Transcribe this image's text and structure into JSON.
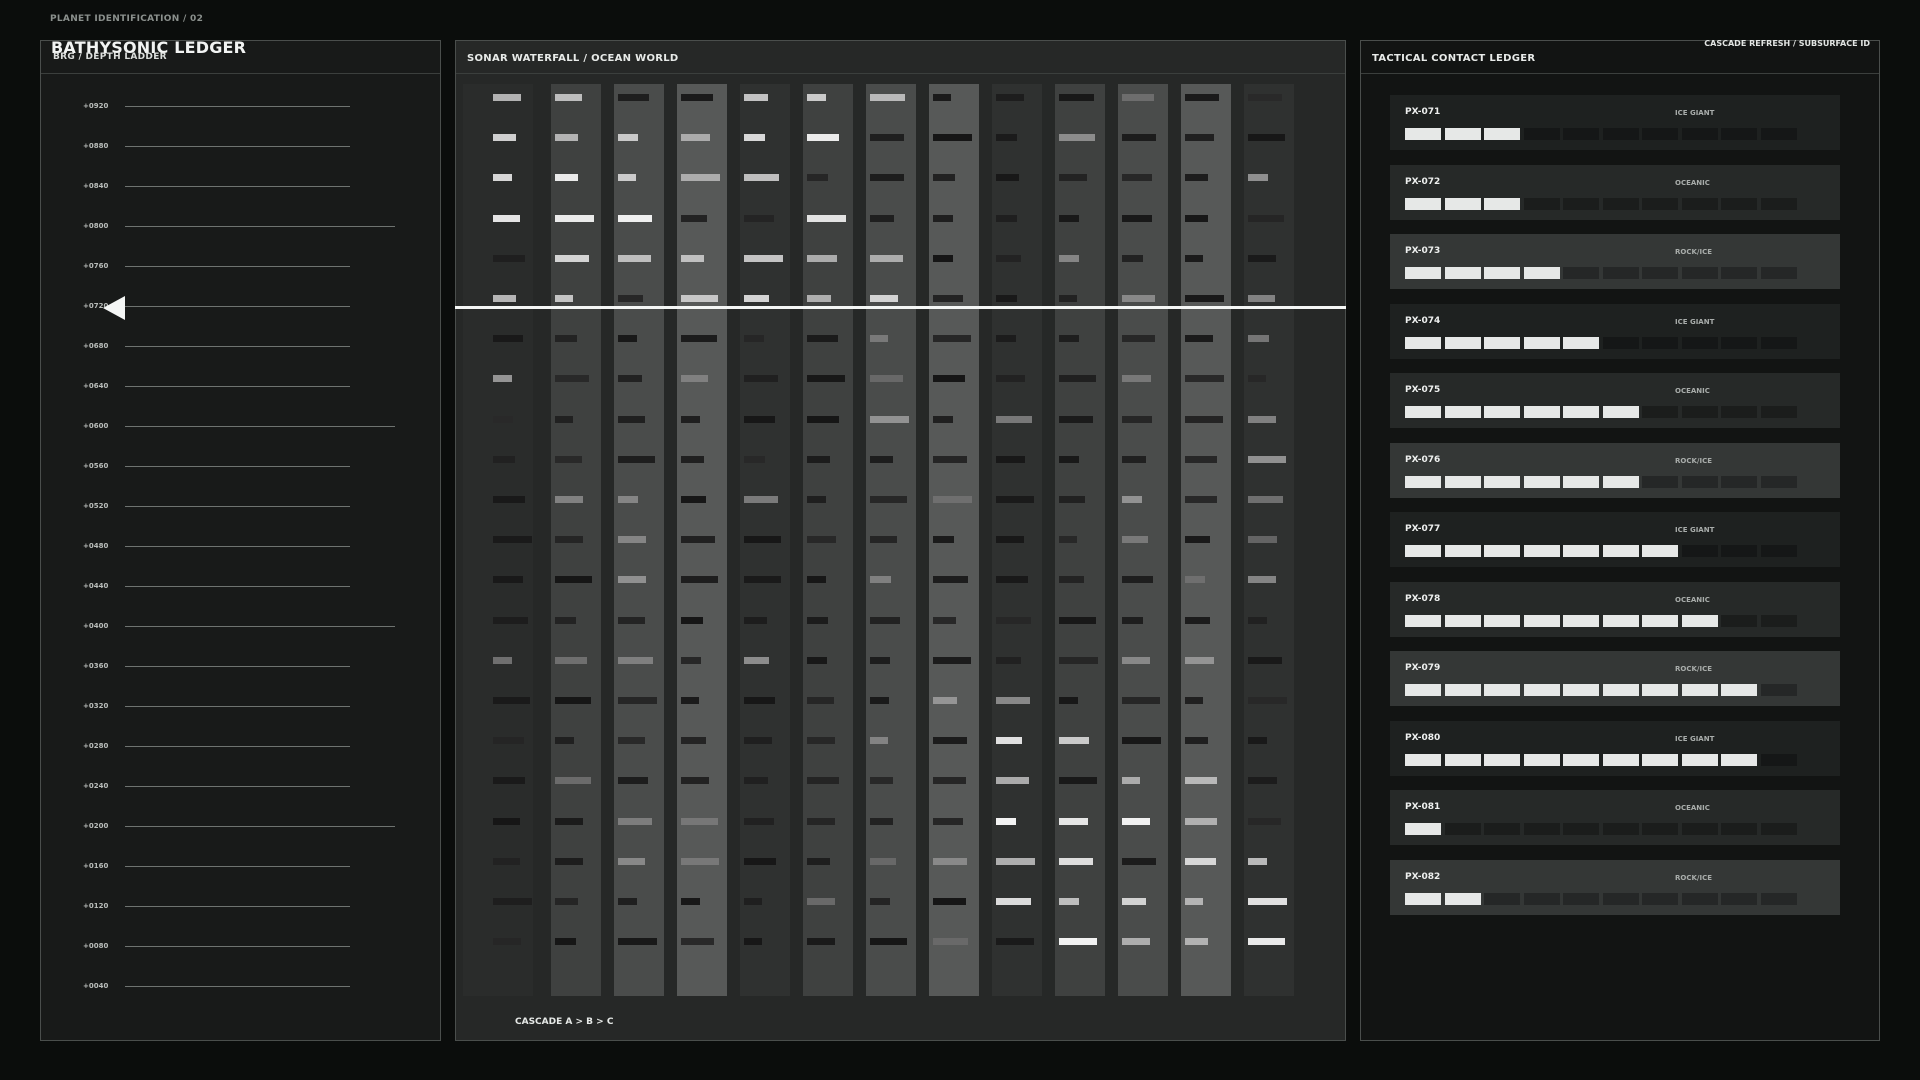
{
  "header": {
    "label": "PLANET IDENTIFICATION / 02"
  },
  "left_panel": {
    "title": "BATHYSONIC LEDGER",
    "subtitle": "BRG / DEPTH LADDER",
    "depth_labels": [
      "+0920",
      "+0880",
      "+0840",
      "+0800",
      "+0760",
      "+0720",
      "+0680",
      "+0640",
      "+0600",
      "+0560",
      "+0520",
      "+0480",
      "+0440",
      "+0400",
      "+0360",
      "+0320",
      "+0280",
      "+0240",
      "+0200",
      "+0160",
      "+0120",
      "+0080",
      "+0040"
    ],
    "major_ticks": [
      "+0800",
      "+0600",
      "+0400",
      "+0200"
    ],
    "marker_depth": "+0720"
  },
  "middle_panel": {
    "title": "SONAR WATERFALL / OCEAN WORLD",
    "cascade_label": "CASCADE  A > B > C",
    "cursor_row": 5.3
  },
  "right_panel": {
    "title": "TACTICAL CONTACT LEDGER",
    "corner_label": "CASCADE REFRESH / SUBSURFACE ID",
    "segments_total": 10,
    "contacts": [
      {
        "id": "PX-071",
        "class": "ICE GIANT",
        "level": 3
      },
      {
        "id": "PX-072",
        "class": "OCEANIC",
        "level": 3
      },
      {
        "id": "PX-073",
        "class": "ROCK/ICE",
        "level": 4
      },
      {
        "id": "PX-074",
        "class": "ICE GIANT",
        "level": 5
      },
      {
        "id": "PX-075",
        "class": "OCEANIC",
        "level": 6
      },
      {
        "id": "PX-076",
        "class": "ROCK/ICE",
        "level": 6
      },
      {
        "id": "PX-077",
        "class": "ICE GIANT",
        "level": 7
      },
      {
        "id": "PX-078",
        "class": "OCEANIC",
        "level": 8
      },
      {
        "id": "PX-079",
        "class": "ROCK/ICE",
        "level": 9
      },
      {
        "id": "PX-080",
        "class": "ICE GIANT",
        "level": 9
      },
      {
        "id": "PX-081",
        "class": "OCEANIC",
        "level": 1
      },
      {
        "id": "PX-082",
        "class": "ROCK/ICE",
        "level": 2
      }
    ]
  },
  "colors": {
    "background": "#0b0d0c",
    "panel_border": "#4a4e4c",
    "segment_on": "#e6e8e7",
    "segment_off": "#2c2f2e",
    "accent": "#f4f6f5"
  }
}
